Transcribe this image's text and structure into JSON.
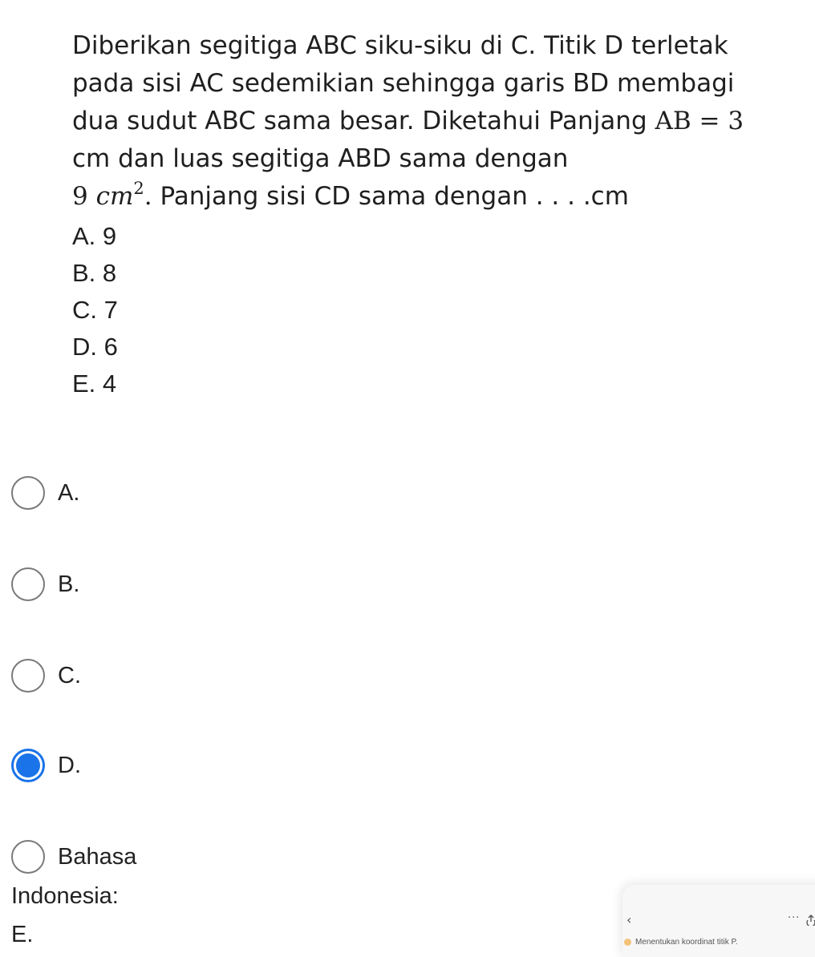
{
  "question": {
    "line1": "Diberikan segitiga ABC siku-siku di C. Titik D terletak",
    "line2": "pada sisi AC sedemikian sehingga garis BD membagi",
    "line3_text": "dua sudut ABC sama besar. Diketahui Panjang ",
    "line3_math": "AB = 3",
    "line4": "cm dan luas segitiga ABD sama dengan",
    "math_value": "9",
    "math_unit": "cm",
    "math_exp": "2",
    "math_dot": ".",
    "line5_text": " Panjang sisi CD sama dengan . . . .cm",
    "choices": [
      "A. 9",
      "B. 8",
      "C. 7",
      "D. 6",
      "E. 4"
    ]
  },
  "answers": {
    "options": [
      {
        "label": "A.",
        "selected": false
      },
      {
        "label": "B.",
        "selected": false
      },
      {
        "label": "C.",
        "selected": false
      },
      {
        "label": "D.",
        "selected": true
      },
      {
        "label": "Bahasa",
        "selected": false
      }
    ],
    "wrap_line1": "Indonesia:",
    "wrap_line2": "E."
  },
  "popup": {
    "back_icon": "‹",
    "more_icon": "···",
    "item_label": "Menentukan koordinat titik P."
  },
  "colors": {
    "accent": "#1a73e8",
    "text": "#222222",
    "popup_bg": "#f7f7f7"
  }
}
